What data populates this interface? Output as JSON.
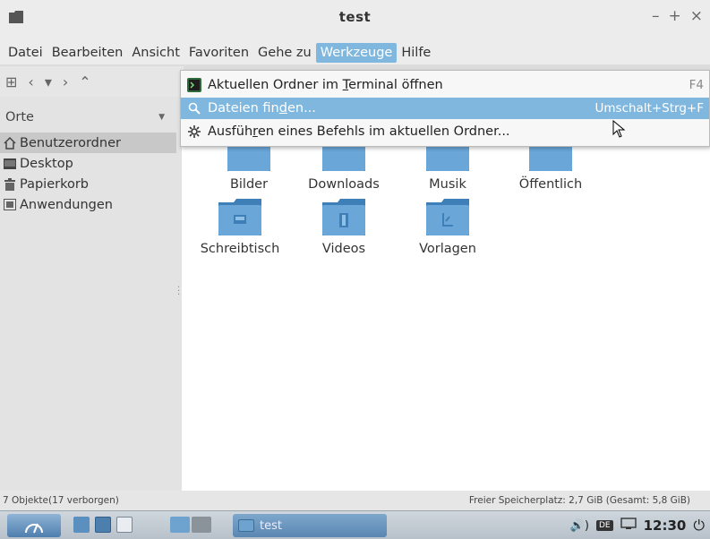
{
  "window": {
    "title": "test",
    "btn_minimize": "–",
    "btn_maximize": "+",
    "btn_close": "×"
  },
  "menubar": [
    "Datei",
    "Bearbeiten",
    "Ansicht",
    "Favoriten",
    "Gehe zu",
    "Werkzeuge",
    "Hilfe"
  ],
  "toolbar": {
    "new_tab": "⊞",
    "back": "‹",
    "history": "▾",
    "forward": "›",
    "up": "⌃"
  },
  "sidebar": {
    "places_label": "Orte",
    "items": [
      {
        "label": "Benutzerordner",
        "icon": "home-icon"
      },
      {
        "label": "Desktop",
        "icon": "desktop-icon"
      },
      {
        "label": "Papierkorb",
        "icon": "trash-icon"
      },
      {
        "label": "Anwendungen",
        "icon": "applications-icon"
      }
    ]
  },
  "folders": [
    {
      "label": "Bilder",
      "icon": "pictures-folder-icon"
    },
    {
      "label": "Downloads",
      "icon": "downloads-folder-icon"
    },
    {
      "label": "Musik",
      "icon": "music-folder-icon"
    },
    {
      "label": "Öffentlich",
      "icon": "public-folder-icon"
    },
    {
      "label": "Schreibtisch",
      "icon": "desktop-folder-icon"
    },
    {
      "label": "Videos",
      "icon": "videos-folder-icon"
    },
    {
      "label": "Vorlagen",
      "icon": "templates-folder-icon"
    }
  ],
  "dropdown": {
    "items": [
      {
        "pre": "Aktuellen Ordner im ",
        "ul": "T",
        "post": "erminal öffnen",
        "shortcut": "F4",
        "icon": "terminal-icon"
      },
      {
        "pre": "Dateien fin",
        "ul": "d",
        "post": "en...",
        "shortcut": "Umschalt+Strg+F",
        "icon": "search-icon"
      },
      {
        "pre": "Ausfüh",
        "ul": "r",
        "post": "en eines Befehls im aktuellen Ordner...",
        "shortcut": "",
        "icon": "gear-icon"
      }
    ]
  },
  "status": {
    "left": "7 Objekte(17 verborgen)",
    "right": "Freier Speicherplatz: 2,7 GiB (Gesamt: 5,8 GiB)"
  },
  "taskbar": {
    "task_label": "test",
    "volume": "🔊)",
    "keyboard": "DE",
    "clock": "12:30",
    "power": "⏻"
  },
  "colors": {
    "accent": "#7fb7df",
    "folder": "#6aa6d8",
    "folder_dark": "#3f7fb7"
  }
}
